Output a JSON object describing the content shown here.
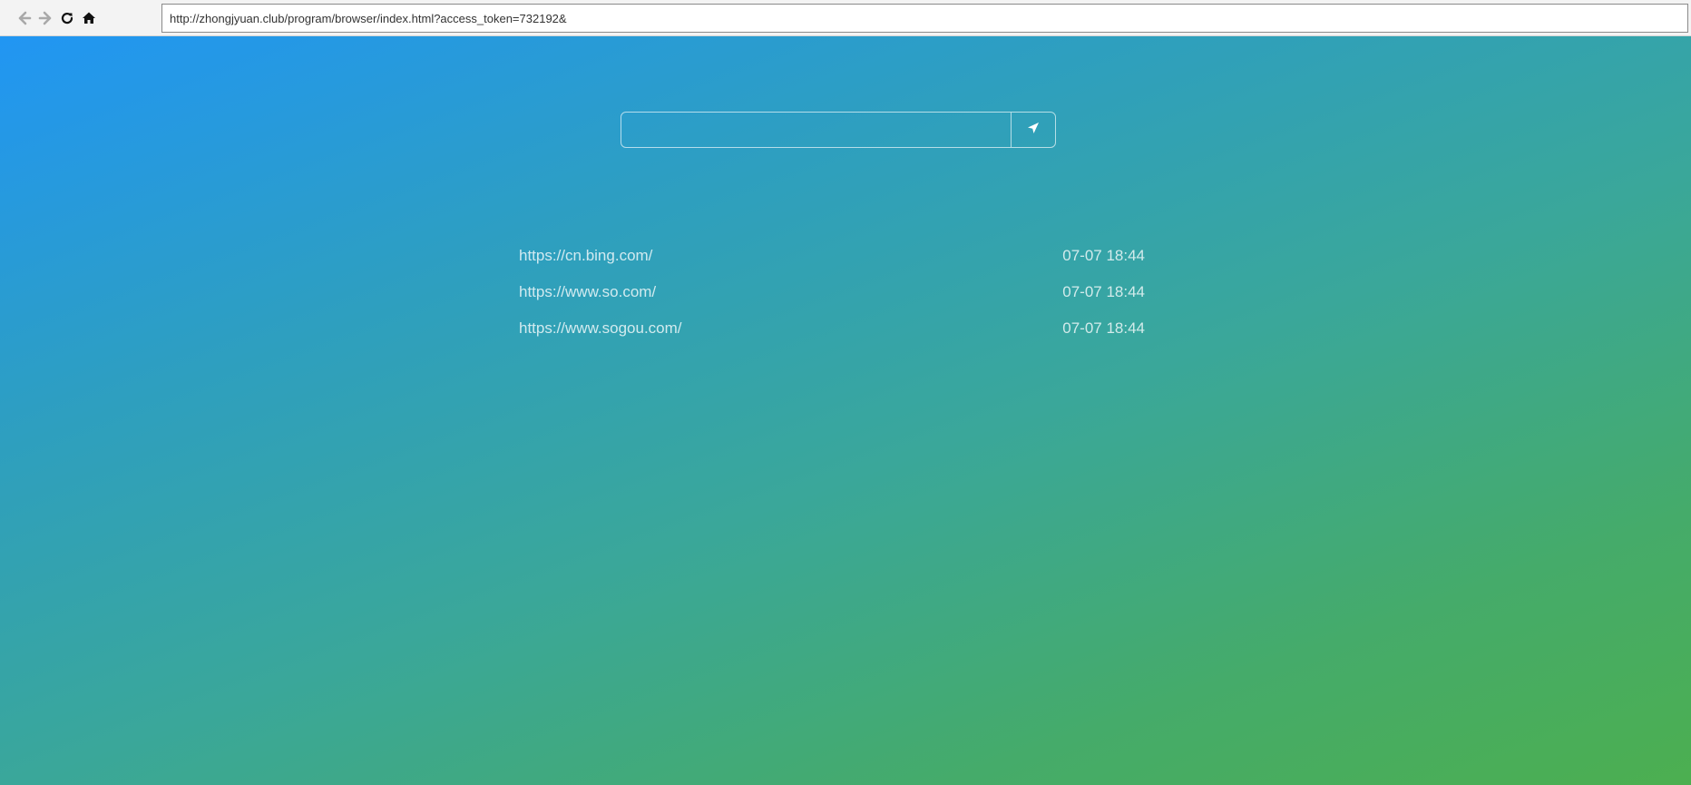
{
  "browser": {
    "url": "http://zhongjyuan.club/program/browser/index.html?access_token=732192&",
    "buttons": [
      {
        "name": "back-button",
        "icon": "arrow-left-icon"
      },
      {
        "name": "forward-button",
        "icon": "arrow-right-icon"
      },
      {
        "name": "reload-button",
        "icon": "reload-icon"
      },
      {
        "name": "home-button",
        "icon": "home-icon"
      }
    ]
  },
  "search": {
    "placeholder": "",
    "value": "",
    "submit_icon": "send-arrow-icon"
  },
  "history": [
    {
      "url": "https://cn.bing.com/",
      "time": "07-07 18:44"
    },
    {
      "url": "https://www.so.com/",
      "time": "07-07 18:44"
    },
    {
      "url": "https://www.sogou.com/",
      "time": "07-07 18:44"
    }
  ],
  "colors": {
    "gradient_start": "#2196f3",
    "gradient_end": "#4caf50",
    "toolbar_bg": "#f3f3f3"
  }
}
